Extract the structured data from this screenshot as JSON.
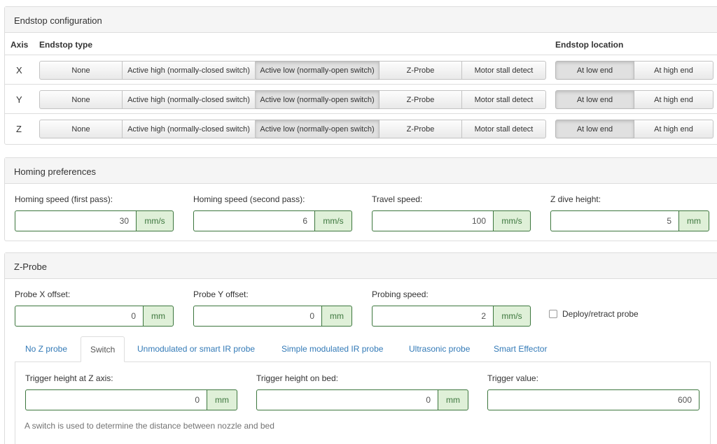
{
  "endstop": {
    "heading": "Endstop configuration",
    "col_axis": "Axis",
    "col_type": "Endstop type",
    "col_location": "Endstop location",
    "type_options": [
      "None",
      "Active high (normally-closed switch)",
      "Active low (normally-open switch)",
      "Z-Probe",
      "Motor stall detect"
    ],
    "location_options": [
      "At low end",
      "At high end"
    ],
    "rows": [
      {
        "axis": "X",
        "active_type": 2,
        "active_location": 0
      },
      {
        "axis": "Y",
        "active_type": 2,
        "active_location": 0
      },
      {
        "axis": "Z",
        "active_type": 2,
        "active_location": 0
      }
    ]
  },
  "homing": {
    "heading": "Homing preferences",
    "fields": [
      {
        "label": "Homing speed (first pass):",
        "value": "30",
        "unit": "mm/s"
      },
      {
        "label": "Homing speed (second pass):",
        "value": "6",
        "unit": "mm/s"
      },
      {
        "label": "Travel speed:",
        "value": "100",
        "unit": "mm/s"
      },
      {
        "label": "Z dive height:",
        "value": "5",
        "unit": "mm"
      }
    ]
  },
  "zprobe": {
    "heading": "Z-Probe",
    "fields": [
      {
        "label": "Probe X offset:",
        "value": "0",
        "unit": "mm"
      },
      {
        "label": "Probe Y offset:",
        "value": "0",
        "unit": "mm"
      },
      {
        "label": "Probing speed:",
        "value": "2",
        "unit": "mm/s"
      }
    ],
    "deploy_label": "Deploy/retract probe",
    "tabs": [
      "No Z probe",
      "Switch",
      "Unmodulated or smart IR probe",
      "Simple modulated IR probe",
      "Ultrasonic probe",
      "Smart Effector"
    ],
    "active_tab": 1,
    "switch": {
      "trigger_z_label": "Trigger height at Z axis:",
      "trigger_z_value": "0",
      "trigger_z_unit": "mm",
      "trigger_bed_label": "Trigger height on bed:",
      "trigger_bed_value": "0",
      "trigger_bed_unit": "mm",
      "trigger_value_label": "Trigger value:",
      "trigger_value": "600",
      "help": "A switch is used to determine the distance between nozzle and bed"
    }
  }
}
